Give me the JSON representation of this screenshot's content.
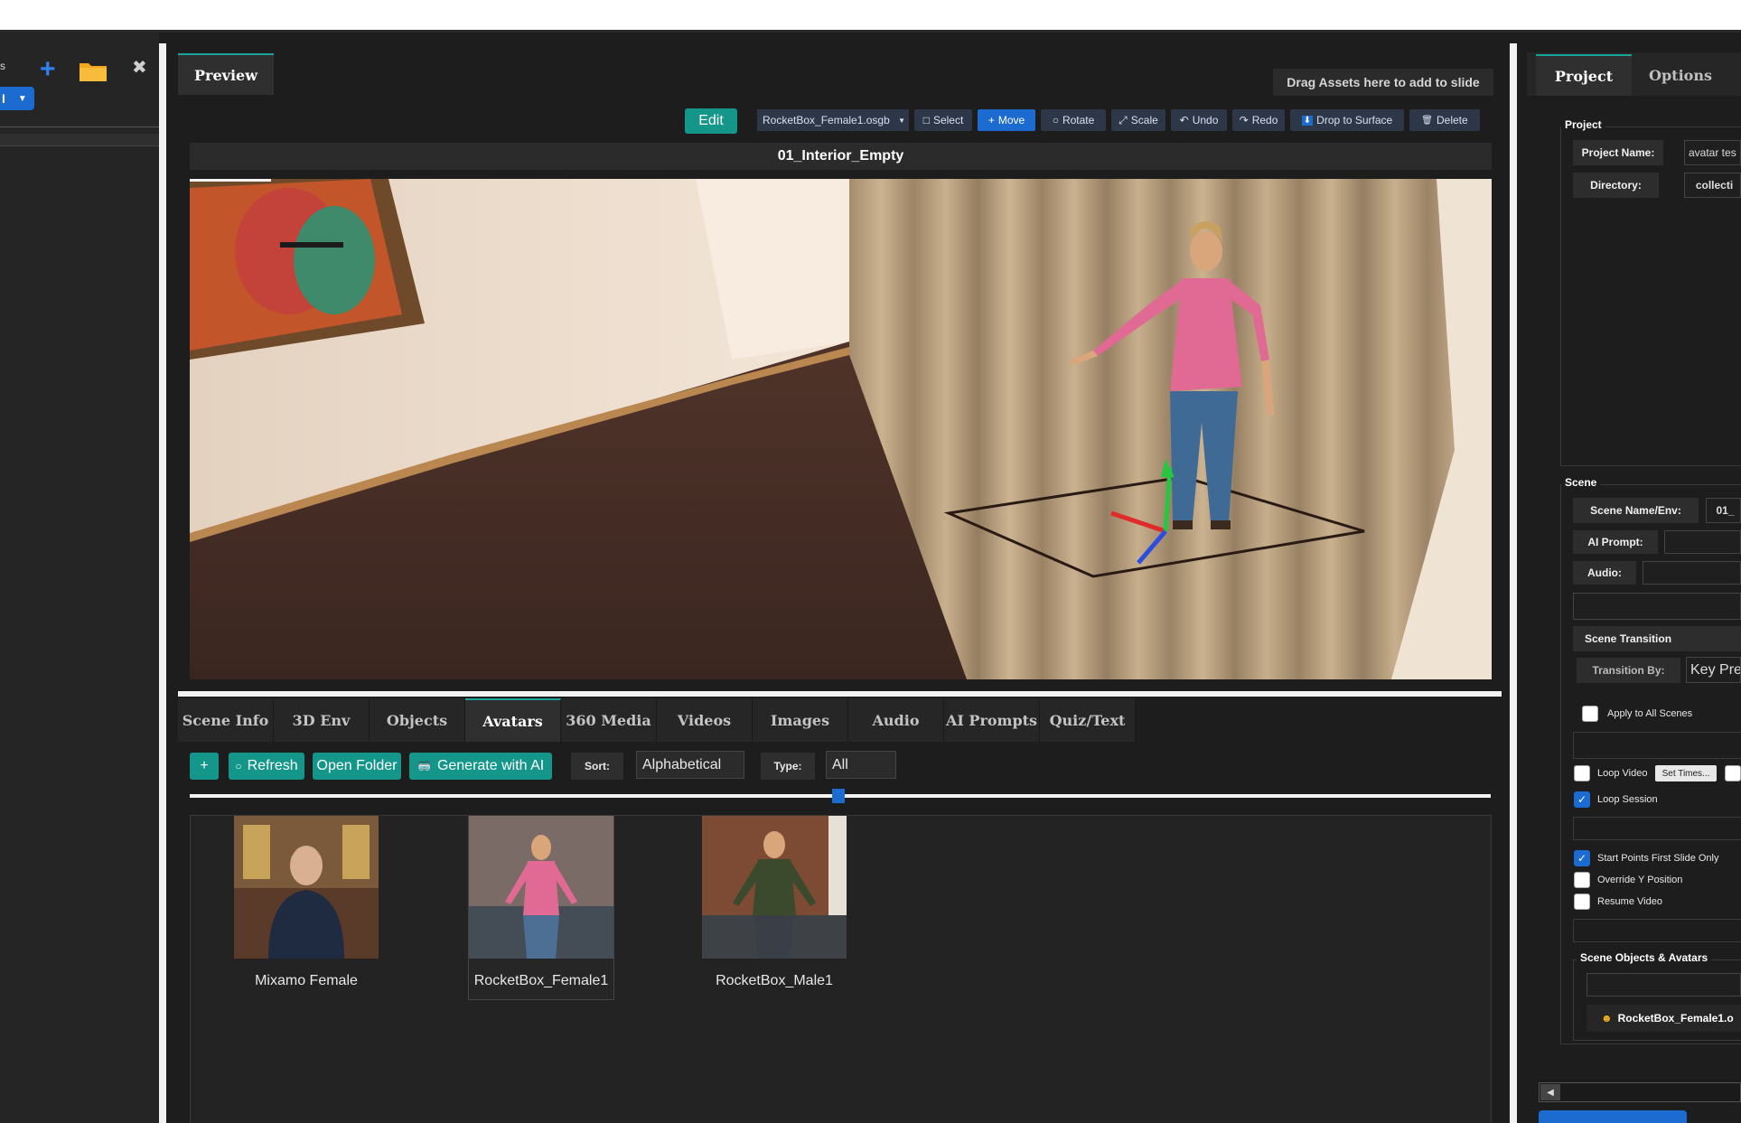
{
  "left": {
    "partial_label": "s",
    "ai_label": "I"
  },
  "center": {
    "preview_tab": "Preview",
    "drag_hint": "Drag Assets here to add to slide",
    "edit_label": "Edit",
    "asset_select": "RocketBox_Female1.osgb",
    "tools": [
      {
        "label": "Select",
        "icon": "□"
      },
      {
        "label": "Move",
        "icon": "+"
      },
      {
        "label": "Rotate",
        "icon": "○"
      },
      {
        "label": "Scale",
        "icon": "⤢"
      },
      {
        "label": "Undo",
        "icon": "↶"
      },
      {
        "label": "Redo",
        "icon": "↷"
      },
      {
        "label": "Drop to Surface",
        "icon": "⬇"
      },
      {
        "label": "Delete",
        "icon": "🗑"
      }
    ],
    "scene_title": "01_Interior_Empty",
    "tabs": [
      "Scene Info",
      "3D Env",
      "Objects",
      "Avatars",
      "360 Media",
      "Videos",
      "Images",
      "Audio",
      "AI Prompts",
      "Quiz/Text"
    ],
    "active_tab": "Avatars",
    "add_label": "+",
    "refresh_label": "Refresh",
    "open_folder_label": "Open Folder",
    "generate_label": "Generate with AI",
    "sort_label": "Sort:",
    "sort_value": "Alphabetical",
    "type_label": "Type:",
    "type_value": "All",
    "size_slider": 0.5,
    "avatars": [
      {
        "name": "Mixamo Female",
        "selected": false
      },
      {
        "name": "RocketBox_Female1",
        "selected": true
      },
      {
        "name": "RocketBox_Male1",
        "selected": false
      }
    ]
  },
  "right": {
    "tabs": [
      "Project",
      "Options"
    ],
    "project_section": "Project",
    "project_name_label": "Project Name:",
    "project_name_value": "avatar tes",
    "directory_label": "Directory:",
    "directory_value": "collecti",
    "scene_section": "Scene",
    "scene_name_label": "Scene Name/Env:",
    "scene_name_value": "01_",
    "ai_prompt_label": "AI Prompt:",
    "audio_label": "Audio:",
    "scene_transition_label": "Scene Transition",
    "transition_by_label": "Transition By:",
    "transition_by_value": "Key Pres",
    "apply_all_label": "Apply to All Scenes",
    "loop_video_label": "Loop Video",
    "set_times_label": "Set Times...",
    "loop_session_label": "Loop Session",
    "start_points_label": "Start Points First Slide Only",
    "override_y_label": "Override Y Position",
    "resume_video_label": "Resume Video",
    "scene_objects_label": "Scene Objects & Avatars",
    "scene_object_item": "RocketBox_Female1.o"
  },
  "colors": {
    "accent_teal": "#14968a",
    "accent_blue": "#1b6bd1"
  }
}
